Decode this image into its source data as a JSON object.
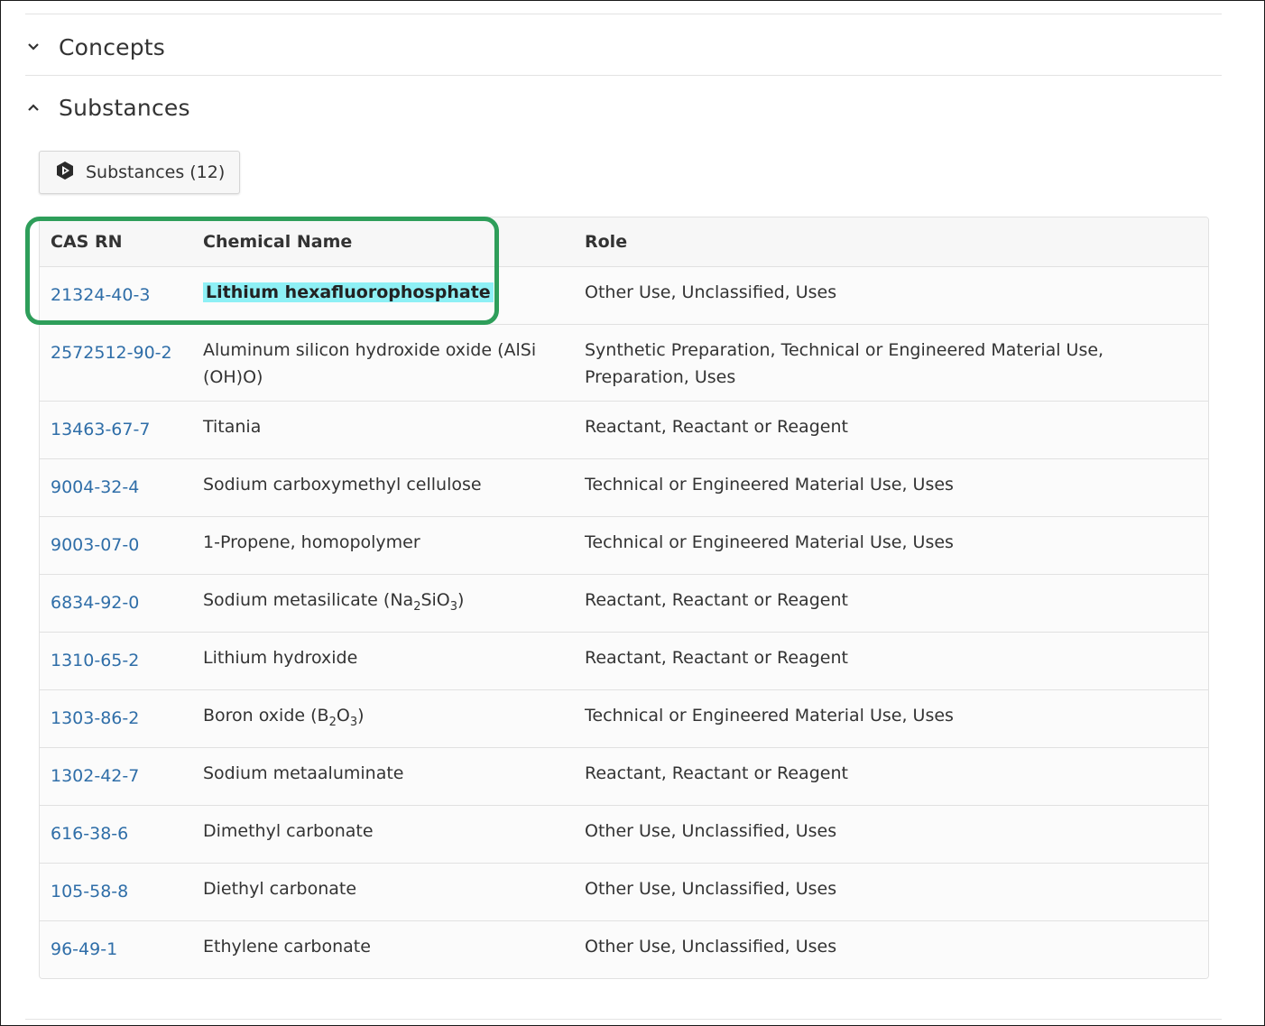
{
  "sections": {
    "concepts": {
      "title": "Concepts",
      "expanded": false
    },
    "substances": {
      "title": "Substances",
      "expanded": true
    }
  },
  "substances_button": {
    "label": "Substances (12)",
    "icon": "substance-hexagon-icon"
  },
  "table": {
    "headers": {
      "cas": "CAS RN",
      "name": "Chemical Name",
      "role": "Role"
    },
    "rows": [
      {
        "cas": "21324-40-3",
        "name": "Lithium hexafluorophosphate",
        "role": "Other Use, Unclassified, Uses",
        "highlighted": true
      },
      {
        "cas": "2572512-90-2",
        "name": "Aluminum silicon hydroxide oxide (AlSi(OH)O)",
        "role": "Synthetic Preparation, Technical or Engineered Material Use, Preparation, Uses"
      },
      {
        "cas": "13463-67-7",
        "name": "Titania",
        "role": "Reactant, Reactant or Reagent"
      },
      {
        "cas": "9004-32-4",
        "name": "Sodium carboxymethyl cellulose",
        "role": "Technical or Engineered Material Use, Uses"
      },
      {
        "cas": "9003-07-0",
        "name": "1-Propene, homopolymer",
        "role": "Technical or Engineered Material Use, Uses"
      },
      {
        "cas": "6834-92-0",
        "name_parts": [
          "Sodium metasilicate (Na",
          "2",
          "SiO",
          "3",
          ")"
        ],
        "role": "Reactant, Reactant or Reagent"
      },
      {
        "cas": "1310-65-2",
        "name": "Lithium hydroxide",
        "role": "Reactant, Reactant or Reagent"
      },
      {
        "cas": "1303-86-2",
        "name_parts": [
          "Boron oxide (B",
          "2",
          "O",
          "3",
          ")"
        ],
        "role": "Technical or Engineered Material Use, Uses"
      },
      {
        "cas": "1302-42-7",
        "name": "Sodium metaaluminate",
        "role": "Reactant, Reactant or Reagent"
      },
      {
        "cas": "616-38-6",
        "name": "Dimethyl carbonate",
        "role": "Other Use, Unclassified, Uses"
      },
      {
        "cas": "105-58-8",
        "name": "Diethyl carbonate",
        "role": "Other Use, Unclassified, Uses"
      },
      {
        "cas": "96-49-1",
        "name": "Ethylene carbonate",
        "role": "Other Use, Unclassified, Uses"
      }
    ]
  },
  "colors": {
    "link": "#2f6ea8",
    "highlight": "#8ef0f5",
    "callout": "#2e9e5a"
  }
}
